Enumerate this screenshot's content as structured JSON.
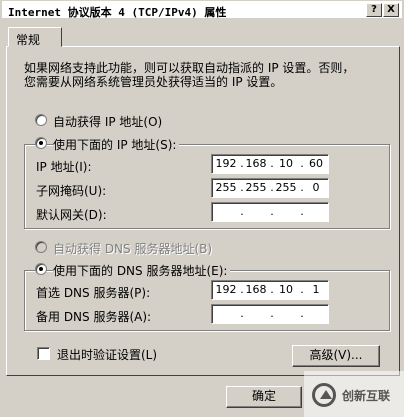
{
  "window": {
    "title": "Internet 协议版本 4 (TCP/IPv4) 属性",
    "help_btn": "?",
    "close_btn": "X"
  },
  "tab": {
    "label": "常规"
  },
  "intro": {
    "line1": "如果网络支持此功能，则可以获取自动指派的 IP 设置。否则，",
    "line2": "您需要从网络系统管理员处获得适当的 IP 设置。"
  },
  "ip": {
    "auto_label": "自动获得 IP 地址(O)",
    "manual_label": "使用下面的 IP 地址(S):",
    "address_label": "IP 地址(I):",
    "address": [
      "192",
      "168",
      "10",
      "60"
    ],
    "mask_label": "子网掩码(U):",
    "mask": [
      "255",
      "255",
      "255",
      "0"
    ],
    "gateway_label": "默认网关(D):",
    "gateway": [
      "",
      "",
      "",
      ""
    ]
  },
  "dns": {
    "auto_label": "自动获得 DNS 服务器地址(B)",
    "manual_label": "使用下面的 DNS 服务器地址(E):",
    "preferred_label": "首选 DNS 服务器(P):",
    "preferred": [
      "192",
      "168",
      "10",
      "1"
    ],
    "alternate_label": "备用 DNS 服务器(A):",
    "alternate": [
      "",
      "",
      "",
      ""
    ]
  },
  "validate_label": "退出时验证设置(L)",
  "advanced_label": "高级(V)...",
  "ok_label": "确定",
  "dot": ".",
  "watermark": "创新互联"
}
